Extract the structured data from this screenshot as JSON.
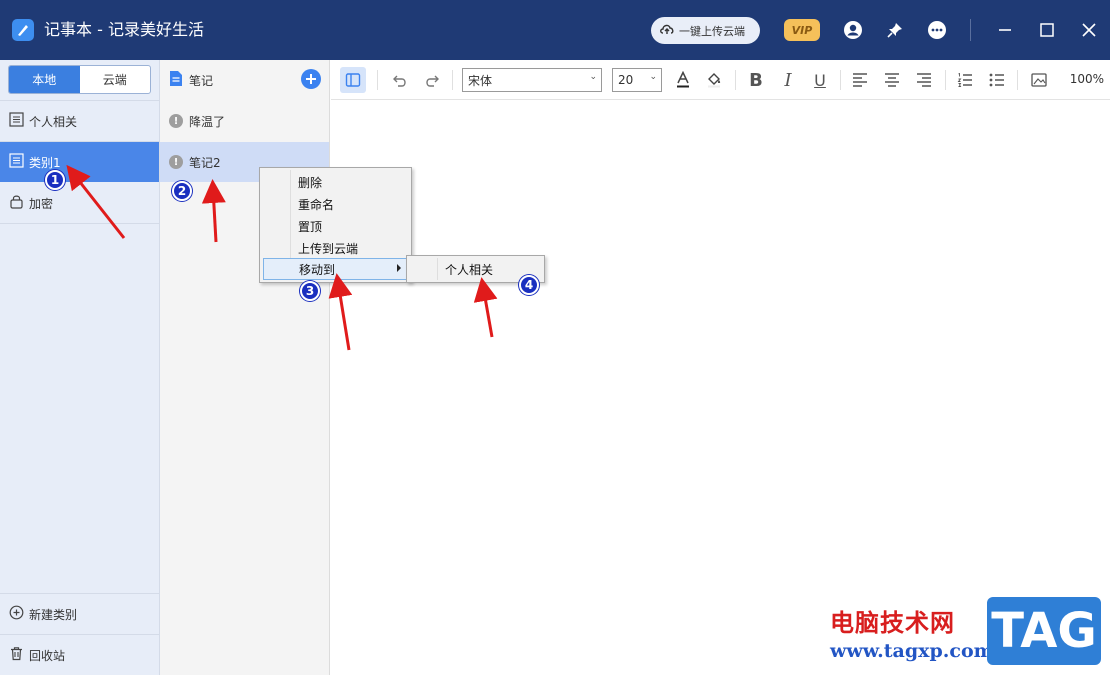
{
  "titlebar": {
    "title": "记事本 - 记录美好生活",
    "upload_label": "一键上传云端",
    "vip_label": "VIP"
  },
  "sidebar": {
    "tabs": [
      {
        "label": "本地",
        "active": true
      },
      {
        "label": "云端",
        "active": false
      }
    ],
    "categories": [
      {
        "label": "个人相关"
      },
      {
        "label": "类别1",
        "active": true
      },
      {
        "label": "加密"
      }
    ],
    "new_category_label": "新建类别",
    "recycle_label": "回收站"
  },
  "notelist": {
    "header": "笔记",
    "notes": [
      {
        "title": "降温了"
      },
      {
        "title": "笔记2",
        "selected": true
      }
    ]
  },
  "toolbar": {
    "font_name": "宋体",
    "font_size": "20",
    "zoom": "100%"
  },
  "context_menu": {
    "items": [
      "删除",
      "重命名",
      "置顶",
      "上传到云端",
      "移动到"
    ],
    "submenu_items": [
      "个人相关"
    ]
  },
  "annotations": [
    "1",
    "2",
    "3",
    "4"
  ],
  "watermark": {
    "text": "电脑技术网",
    "url": "www.tagxp.com",
    "logo": "TAG"
  },
  "colors": {
    "titlebar": "#1f3a75",
    "accent": "#4a86e8",
    "annotation_arrow": "#e01b1b",
    "annotation_badge": "#1a2fbf"
  }
}
